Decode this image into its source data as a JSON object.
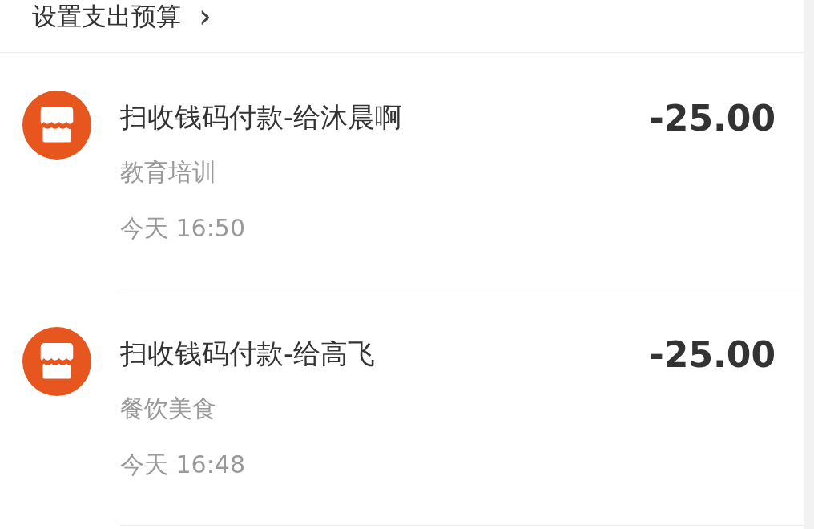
{
  "budget_link": {
    "label": "设置支出预算",
    "arrow": "›"
  },
  "transactions": [
    {
      "title": "扫收钱码付款-给沐晨啊",
      "category": "教育培训",
      "time": "今天 16:50",
      "amount": "-25.00"
    },
    {
      "title": "扫收钱码付款-给高飞",
      "category": "餐饮美食",
      "time": "今天 16:48",
      "amount": "-25.00"
    }
  ]
}
